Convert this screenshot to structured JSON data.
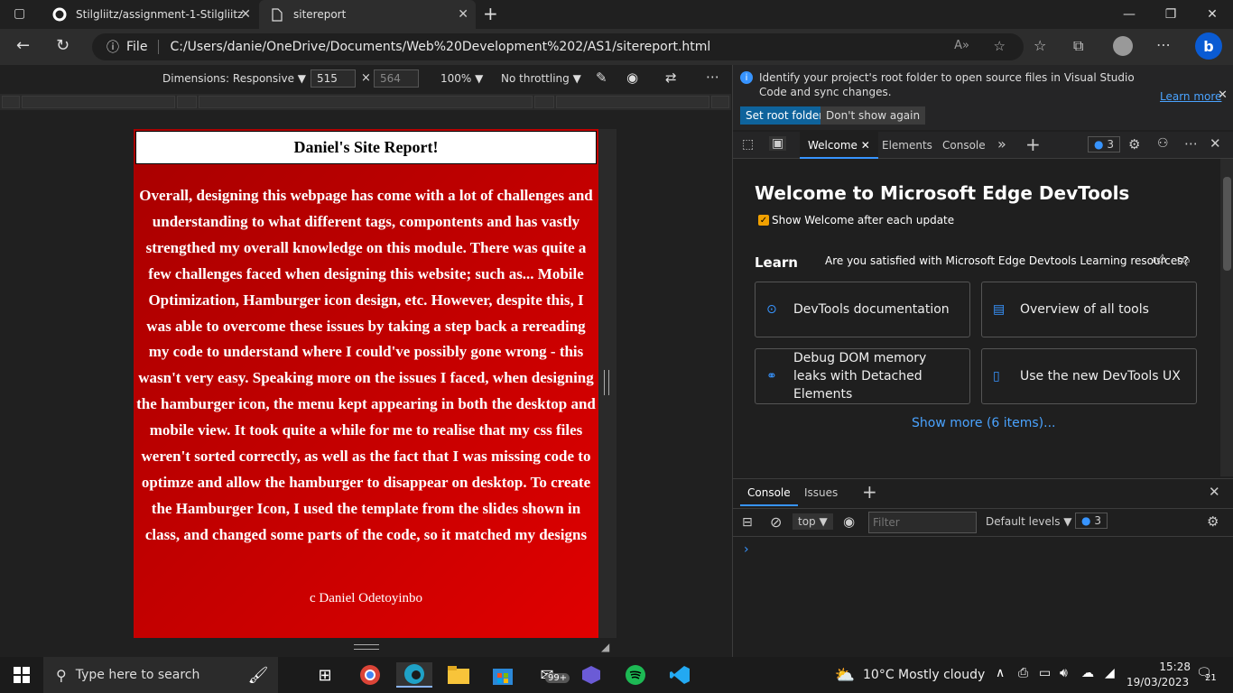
{
  "browser": {
    "tabs": [
      {
        "title": "Stilgliitz/assignment-1-Stilgliitz",
        "close": "✕"
      },
      {
        "title": "sitereport",
        "close": "✕"
      }
    ],
    "new_tab": "+",
    "window_controls": {
      "minimize": "—",
      "maximize": "❐",
      "close": "✕"
    },
    "address": {
      "scheme_label": "File",
      "url": "C:/Users/danie/OneDrive/Documents/Web%20Development%202/AS1/sitereport.html"
    }
  },
  "device_toolbar": {
    "dimensions_label": "Dimensions: Responsive",
    "width": "515",
    "times": "×",
    "height_placeholder": "564",
    "zoom": "100%",
    "throttling": "No throttling"
  },
  "page": {
    "title": "Daniel's Site Report!",
    "body": "Overall, designing this webpage has come with a lot of challenges and understanding to what different tags, compontents and has vastly strengthed my overall knowledge on this module. There was quite a few challenges faced when designing this website; such as... Mobile Optimization, Hamburger icon design, etc. However, despite this, I was able to overcome these issues by taking a step back a rereading my code to understand where I could've possibly gone wrong - this wasn't very easy. Speaking more on the issues I faced, when designing the hamburger icon, the menu kept appearing in both the desktop and mobile view. It took quite a while for me to realise that my css files weren't sorted correctly, as well as the fact that I was missing code to optimze and allow the hamburger to disappear on desktop. To create the Hamburger Icon, I used the template from the slides shown in class, and changed some parts of the code, so it matched my designs",
    "footer": "c Daniel Odetoyinbo"
  },
  "devtools": {
    "infobar": {
      "message": "Identify your project's root folder to open source files in Visual Studio Code and sync changes.",
      "learn_more": "Learn more",
      "set_root": "Set root folder",
      "dont_show": "Don't show again"
    },
    "tabs": {
      "welcome": "Welcome",
      "elements": "Elements",
      "console": "Console",
      "more": "»",
      "add": "+",
      "issues_count": "3"
    },
    "welcome": {
      "heading": "Welcome to Microsoft Edge DevTools",
      "show_after_update": "Show Welcome after each update",
      "learn": "Learn",
      "survey": "Are you satisfied with Microsoft Edge Devtools Learning resources?",
      "cards": [
        {
          "label": "DevTools documentation"
        },
        {
          "label": "Overview of all tools"
        },
        {
          "label": "Debug DOM memory leaks with Detached Elements"
        },
        {
          "label": "Use the new DevTools UX"
        }
      ],
      "show_more": "Show more (6 items)..."
    },
    "console": {
      "tabs": {
        "console": "Console",
        "issues": "Issues",
        "add": "+"
      },
      "context": "top",
      "filter_placeholder": "Filter",
      "levels": "Default levels",
      "count": "3",
      "prompt": "›"
    }
  },
  "taskbar": {
    "search_placeholder": "Type here to search",
    "weather": "10°C  Mostly cloudy",
    "mail_badge": "99+",
    "time": "15:28",
    "date": "19/03/2023",
    "notifications": "21"
  }
}
